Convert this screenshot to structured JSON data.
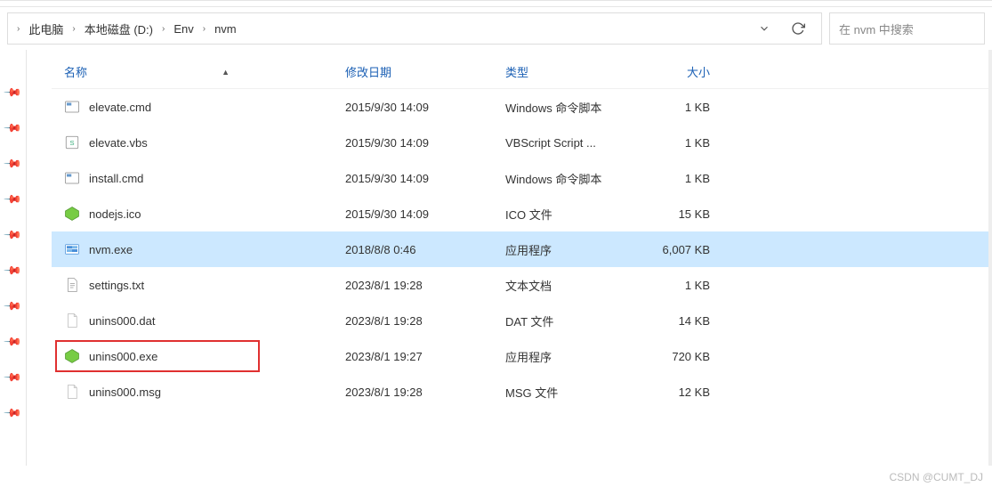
{
  "breadcrumb": {
    "items": [
      "此电脑",
      "本地磁盘 (D:)",
      "Env",
      "nvm"
    ]
  },
  "search": {
    "placeholder": "在 nvm 中搜索"
  },
  "headers": {
    "name": "名称",
    "date": "修改日期",
    "type": "类型",
    "size": "大小"
  },
  "files": [
    {
      "icon": "cmd",
      "name": "elevate.cmd",
      "date": "2015/9/30 14:09",
      "type": "Windows 命令脚本",
      "size": "1 KB",
      "selected": false,
      "highlighted": false
    },
    {
      "icon": "vbs",
      "name": "elevate.vbs",
      "date": "2015/9/30 14:09",
      "type": "VBScript Script ...",
      "size": "1 KB",
      "selected": false,
      "highlighted": false
    },
    {
      "icon": "cmd",
      "name": "install.cmd",
      "date": "2015/9/30 14:09",
      "type": "Windows 命令脚本",
      "size": "1 KB",
      "selected": false,
      "highlighted": false
    },
    {
      "icon": "ico",
      "name": "nodejs.ico",
      "date": "2015/9/30 14:09",
      "type": "ICO 文件",
      "size": "15 KB",
      "selected": false,
      "highlighted": false
    },
    {
      "icon": "exe",
      "name": "nvm.exe",
      "date": "2018/8/8 0:46",
      "type": "应用程序",
      "size": "6,007 KB",
      "selected": true,
      "highlighted": false
    },
    {
      "icon": "txt",
      "name": "settings.txt",
      "date": "2023/8/1 19:28",
      "type": "文本文档",
      "size": "1 KB",
      "selected": false,
      "highlighted": false
    },
    {
      "icon": "file",
      "name": "unins000.dat",
      "date": "2023/8/1 19:28",
      "type": "DAT 文件",
      "size": "14 KB",
      "selected": false,
      "highlighted": false
    },
    {
      "icon": "ico",
      "name": "unins000.exe",
      "date": "2023/8/1 19:27",
      "type": "应用程序",
      "size": "720 KB",
      "selected": false,
      "highlighted": true
    },
    {
      "icon": "file",
      "name": "unins000.msg",
      "date": "2023/8/1 19:28",
      "type": "MSG 文件",
      "size": "12 KB",
      "selected": false,
      "highlighted": false
    }
  ],
  "watermark": "CSDN @CUMT_DJ"
}
